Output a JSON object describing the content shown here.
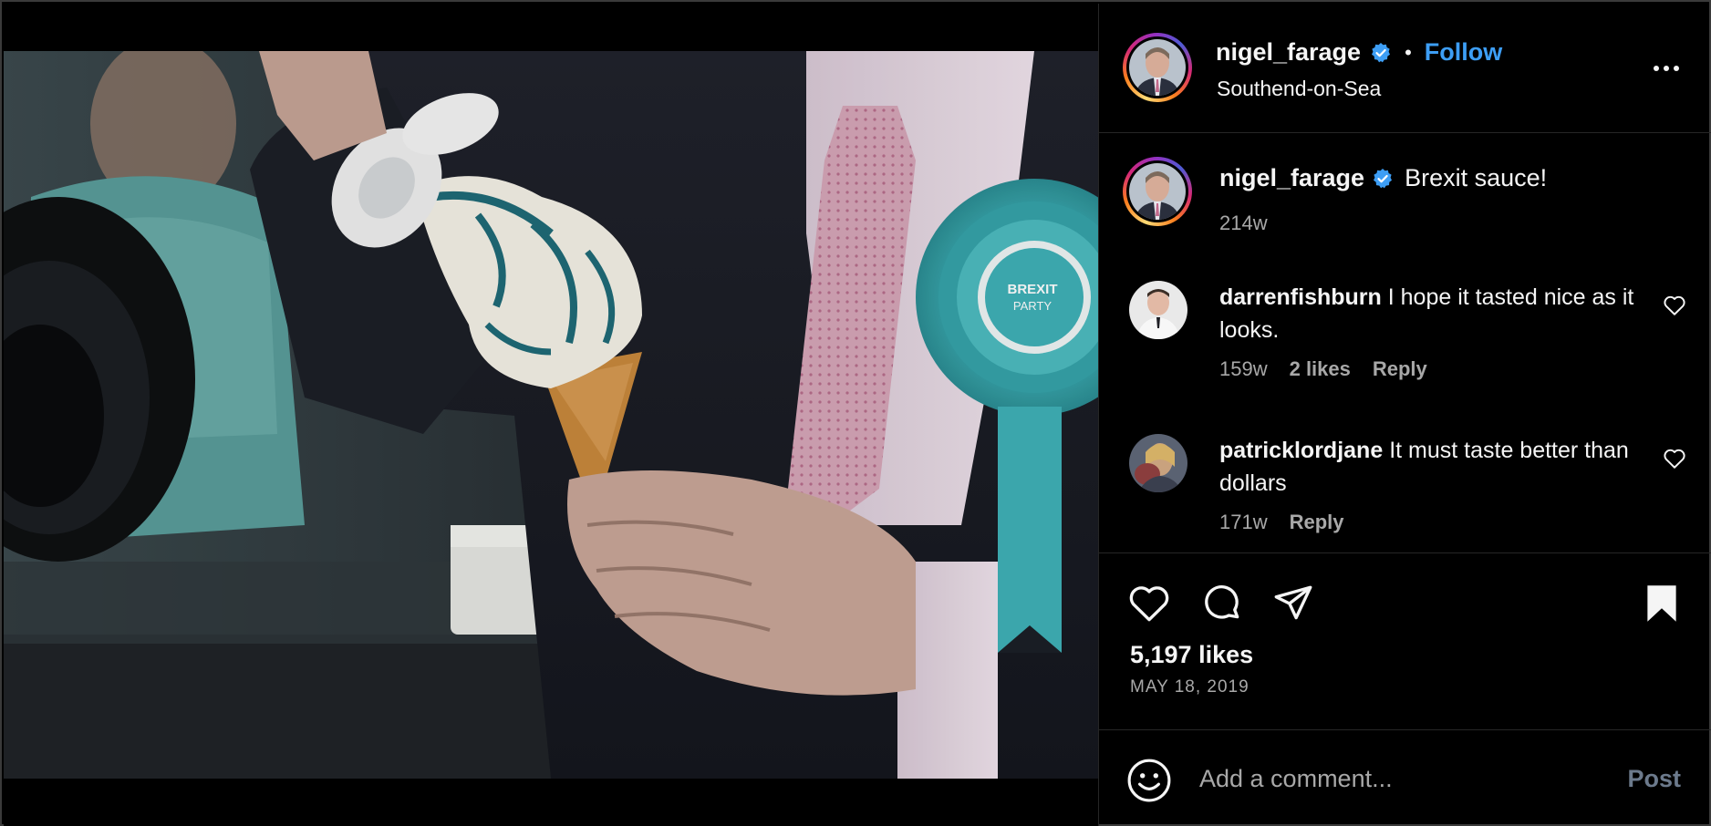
{
  "post": {
    "username": "nigel_farage",
    "verified": true,
    "separator": "•",
    "follow_label": "Follow",
    "location": "Southend-on-Sea",
    "more_icon": "more-horizontal-icon",
    "image_icon": "post-photo"
  },
  "caption": {
    "username": "nigel_farage",
    "text": "Brexit sauce!",
    "time": "214w"
  },
  "comments": [
    {
      "username": "darrenfishburn",
      "text": "I hope it tasted nice as it looks.",
      "time": "159w",
      "likes": "2 likes",
      "reply": "Reply"
    },
    {
      "username": "patricklordjane",
      "text": "It must taste better than dollars",
      "time": "171w",
      "reply": "Reply"
    }
  ],
  "actions": {
    "likes": "5,197 likes",
    "date": "MAY 18, 2019",
    "icons": [
      "heart-icon",
      "comment-icon",
      "share-icon",
      "bookmark-icon"
    ]
  },
  "composer": {
    "placeholder": "Add a comment...",
    "post_label": "Post"
  },
  "colors": {
    "accent": "#3d9ef5",
    "muted": "#a8a8a8",
    "background": "#000000",
    "rosette": "#3fb1b7"
  }
}
